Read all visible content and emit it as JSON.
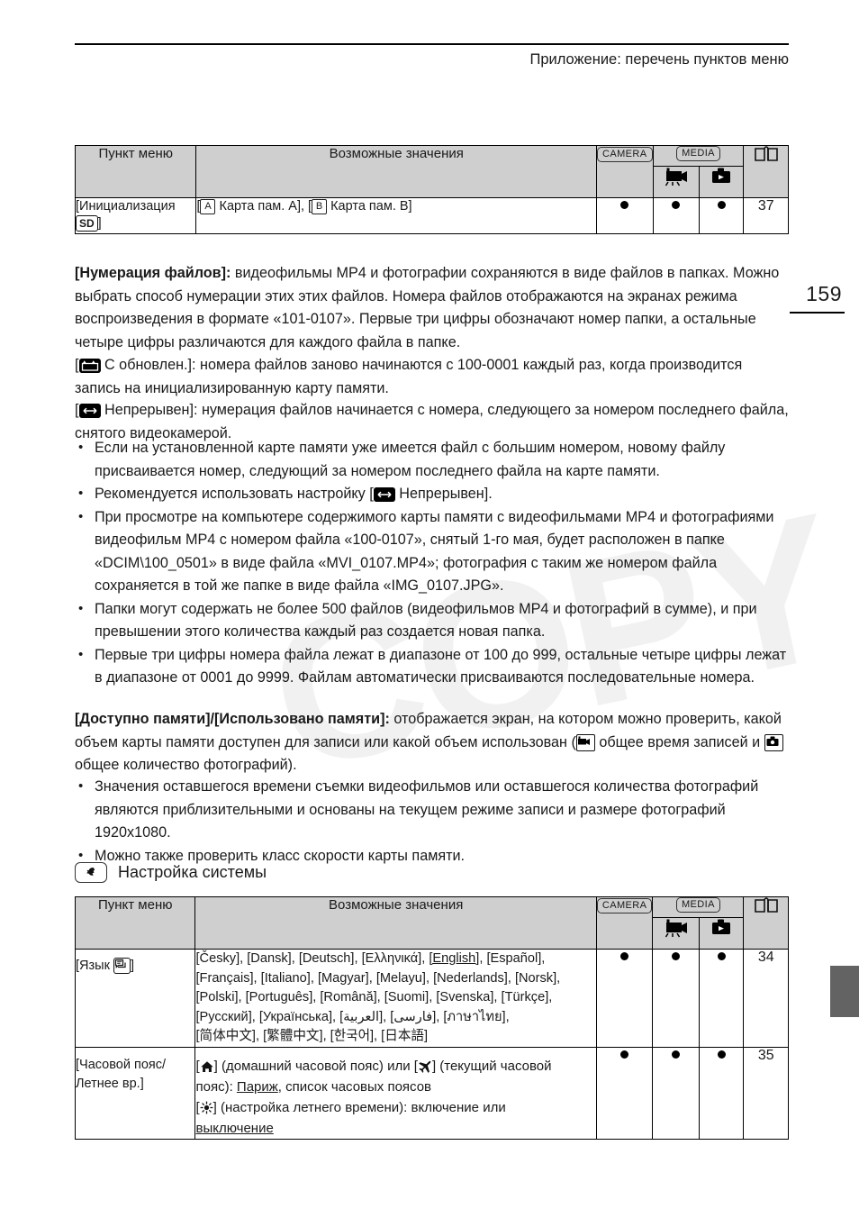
{
  "header": {
    "title": "Приложение: перечень пунктов меню",
    "page_number": "159"
  },
  "table1": {
    "columns": {
      "menu_item": "Пункт меню",
      "possible_values": "Возможные значения",
      "camera": "CAMERA",
      "media": "MEDIA",
      "media_movie_icon": "movie-playback-icon",
      "media_photo_icon": "photo-playback-icon",
      "page_icon": "open-book-icon"
    },
    "rows": [
      {
        "menu_item_prefix": "[Инициализация",
        "menu_item_chip": "SD",
        "menu_item_suffix": "]",
        "values_parts": {
          "open1": "[",
          "chip_a": "A",
          "text_a": "Карта пам. A], [",
          "chip_b": "B",
          "text_b": "Карта пам. B]"
        },
        "camera": "●",
        "media_movie": "●",
        "media_photo": "●",
        "page": "37"
      }
    ]
  },
  "body": {
    "file_numbering": {
      "label": "[Нумерация файлов]:",
      "text": " видеофильмы MP4 и фотографии сохраняются в виде файлов в папках. Можно выбрать способ нумерации этих этих файлов. Номера файлов отображаются на экранах режима воспроизведения в формате «101-0107». Первые три цифры обозначают номер папки, а остальные четыре цифры различаются для каждого файла в папке."
    },
    "reset_option": {
      "open": "[",
      "icon": "file-numbering-reset-icon",
      "text": " С обновлен.]: номера файлов заново начинаются с 100-0001 каждый раз, когда производится запись на инициализированную карту памяти."
    },
    "continuous_option": {
      "open": "[",
      "icon": "file-numbering-continuous-icon",
      "text": " Непрерывен]: нумерация файлов начинается с номера, следующего за номером последнего файла, снятого видеокамерой."
    },
    "bullets_numbering": [
      {
        "text": "Если на установленной карте памяти уже имеется файл с большим номером, новому файлу присваивается номер, следующий за номером последнего файла на карте памяти."
      },
      {
        "prefix": "Рекомендуется использовать настройку [",
        "icon": "file-numbering-continuous-icon",
        "suffix": " Непрерывен]."
      },
      {
        "text": "При просмотре на компьютере содержимого карты памяти с видеофильмами MP4 и фотографиями видеофильм MP4 с номером файла «100-0107», снятый 1-го мая, будет расположен в папке «DCIM\\100_0501» в виде файла «MVI_0107.MP4»; фотография с таким же номером файла сохраняется в той же папке в виде файла «IMG_0107.JPG»."
      },
      {
        "text": "Папки могут содержать не более 500 файлов (видеофильмов MP4 и фотографий в сумме), и при превышении этого количества каждый раз создается новая папка."
      },
      {
        "text": "Первые три цифры номера файла лежат в диапазоне от 100 до 999, остальные четыре цифры лежат в диапазоне от 0001 до 9999. Файлам автоматически присваиваются последовательные номера."
      }
    ],
    "memory_info": {
      "label": "[Доступно памяти]/[Использовано памяти]:",
      "text1": " отображается экран, на котором можно проверить, какой объем карты памяти доступен для записи или какой объем использован (",
      "icon1": "movie-camera-boxed-icon",
      "text2": " общее время записей и ",
      "icon2": "photo-camera-boxed-icon",
      "text3": " общее количество фотографий)."
    },
    "bullets_memory": [
      {
        "text": "Значения оставшегося времени съемки видеофильмов или оставшегося количества фотографий являются приблизительными и основаны на текущем режиме записи и размере фотографий 1920x1080."
      },
      {
        "text": "Можно также проверить класс скорости карты памяти."
      }
    ]
  },
  "section": {
    "icon": "system-setup-wrench-icon",
    "title": "Настройка системы"
  },
  "table2": {
    "columns": {
      "menu_item": "Пункт меню",
      "possible_values": "Возможные значения",
      "camera": "CAMERA",
      "media": "MEDIA",
      "media_movie_icon": "movie-playback-icon",
      "media_photo_icon": "photo-playback-icon",
      "page_icon": "open-book-icon"
    },
    "rows": [
      {
        "menu_item_prefix": "[Язык",
        "menu_item_icon": "language-icon",
        "menu_item_suffix": "]",
        "languages_line1": "[Česky], [Dansk], [Deutsch], [Ελληνικά], ",
        "languages_default": "[English]",
        "languages_line1b": ", [Español],",
        "languages_line2": "[Français], [Italiano], [Magyar], [Melayu], [Nederlands], [Norsk],",
        "languages_line3": "[Polski], [Português], [Română], [Suomi], [Svenska], [Türkçe],",
        "languages_line4": "[Русский], [Українська], [العربية], [فارسی], [ภาษาไทย],",
        "languages_line5": "[简体中文], [繁體中文], [한국어], [日本語]",
        "camera": "●",
        "media_movie": "●",
        "media_photo": "●",
        "page": "34"
      },
      {
        "menu_item_line1": "[Часовой пояс/",
        "menu_item_line2": "Летнее вр.]",
        "tz_open1": "[",
        "tz_icon_home": "home-timezone-icon",
        "tz_text1": "] (домашний часовой пояс) или [",
        "tz_icon_travel": "airplane-timezone-icon",
        "tz_text2": "] (текущий часовой",
        "tz_text3": "пояс): ",
        "tz_city": "Париж",
        "tz_text3b": ", список часовых поясов",
        "tz_open2": "[",
        "tz_icon_dst": "sun-dst-icon",
        "tz_text4": "] (настройка летнего времени): включение или",
        "tz_off": "выключение",
        "camera": "●",
        "media_movie": "●",
        "media_photo": "●",
        "page": "35"
      }
    ]
  },
  "watermark": {
    "text": "COPY"
  }
}
